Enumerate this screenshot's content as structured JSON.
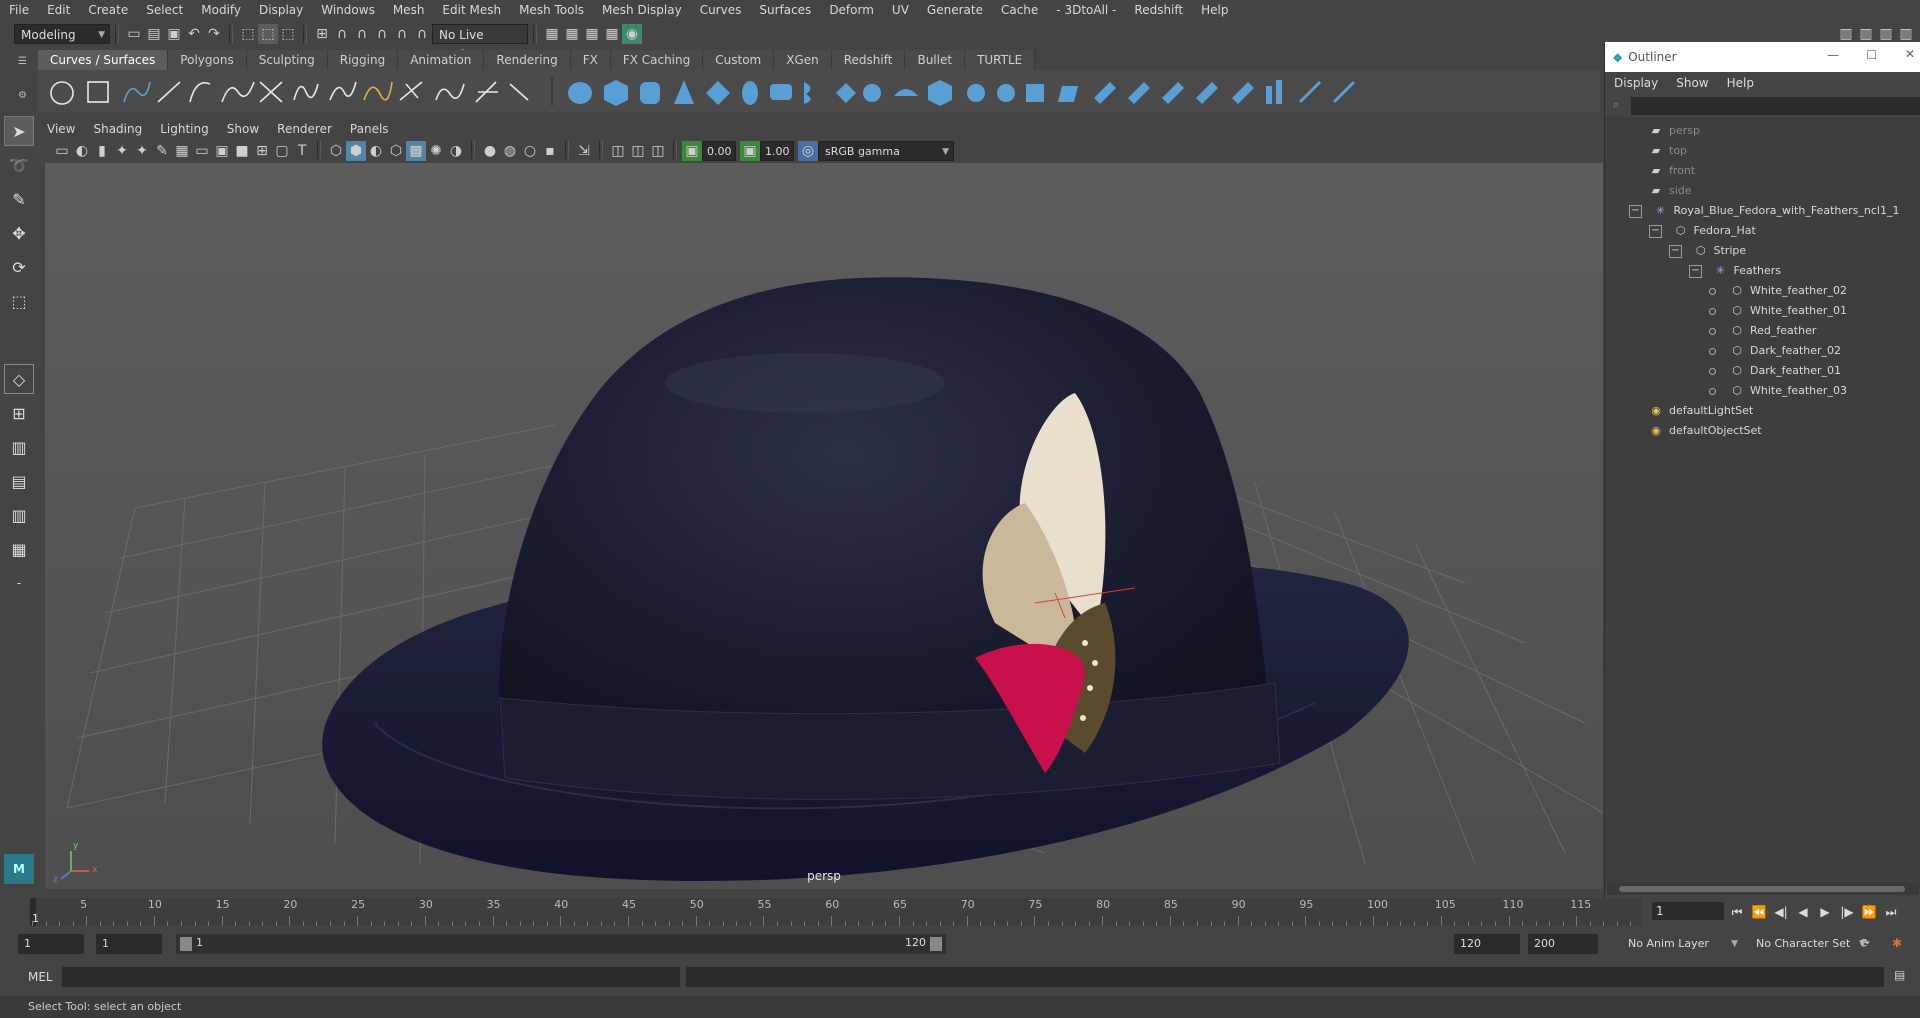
{
  "menubar": {
    "items": [
      "File",
      "Edit",
      "Create",
      "Select",
      "Modify",
      "Display",
      "Windows",
      "Mesh",
      "Edit Mesh",
      "Mesh Tools",
      "Mesh Display",
      "Curves",
      "Surfaces",
      "Deform",
      "UV",
      "Generate",
      "Cache",
      "- 3DtoAll -",
      "Redshift",
      "Help"
    ]
  },
  "statusline": {
    "menuset": "Modeling",
    "live_surface": "No Live Surface"
  },
  "shelf": {
    "tabs": [
      "Curves / Surfaces",
      "Polygons",
      "Sculpting",
      "Rigging",
      "Animation",
      "Rendering",
      "FX",
      "FX Caching",
      "Custom",
      "XGen",
      "Redshift",
      "Bullet",
      "TURTLE"
    ],
    "active_tab": "Curves / Surfaces"
  },
  "viewport": {
    "menu": [
      "View",
      "Shading",
      "Lighting",
      "Show",
      "Renderer",
      "Panels"
    ],
    "near_value": "0.00",
    "far_value": "1.00",
    "color_space": "sRGB gamma",
    "camera": "persp",
    "axis_y": "y",
    "axis_x": "x",
    "axis_z": "z"
  },
  "outliner": {
    "title": "Outliner",
    "menu": [
      "Display",
      "Show",
      "Help"
    ],
    "nodes": {
      "persp": "persp",
      "top": "top",
      "front": "front",
      "side": "side",
      "root": "Royal_Blue_Fedora_with_Feathers_ncl1_1",
      "hat": "Fedora_Hat",
      "stripe": "Stripe",
      "feathers": "Feathers",
      "f1": "White_feather_02",
      "f2": "White_feather_01",
      "f3": "Red_feather",
      "f4": "Dark_feather_02",
      "f5": "Dark_feather_01",
      "f6": "White_feather_03",
      "lightset": "defaultLightSet",
      "objectset": "defaultObjectSet"
    }
  },
  "timeline": {
    "ticks": [
      "1",
      "5",
      "10",
      "15",
      "20",
      "25",
      "30",
      "35",
      "40",
      "45",
      "50",
      "55",
      "60",
      "65",
      "70",
      "75",
      "80",
      "85",
      "90",
      "95",
      "100",
      "105",
      "110",
      "115"
    ],
    "current_frame": "1"
  },
  "range": {
    "start": "1",
    "playback_start": "1",
    "slider_start": "1",
    "slider_end": "120",
    "playback_end": "120",
    "end": "200",
    "anim_layer": "No Anim Layer",
    "character_set": "No Character Set"
  },
  "cmdline": {
    "label": "MEL"
  },
  "helpline": {
    "text": "Select Tool: select an object"
  },
  "colors": {
    "accent": "#5285a6",
    "hat": "#191b30",
    "red_feather": "#c8104a"
  }
}
